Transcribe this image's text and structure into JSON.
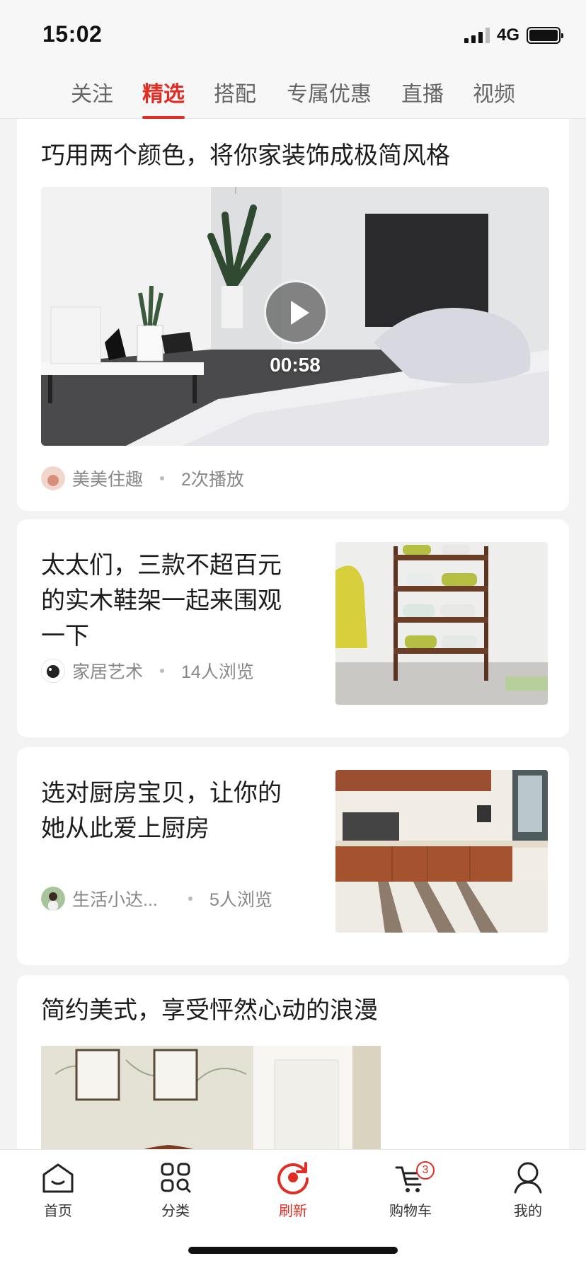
{
  "status_bar": {
    "time": "15:02",
    "network": "4G"
  },
  "top_tabs": [
    {
      "label": "关注",
      "active": false
    },
    {
      "label": "精选",
      "active": true
    },
    {
      "label": "搭配",
      "active": false
    },
    {
      "label": "专属优惠",
      "active": false
    },
    {
      "label": "直播",
      "active": false
    },
    {
      "label": "视频",
      "active": false
    }
  ],
  "feed": [
    {
      "title": "巧用两个颜色，将你家装饰成极简风格",
      "duration": "00:58",
      "author": "美美住趣",
      "stat": "2次播放"
    },
    {
      "title": "太太们，三款不超百元的实木鞋架一起来围观一下",
      "author": "家居艺术",
      "stat": "14人浏览"
    },
    {
      "title": "选对厨房宝贝，让你的她从此爱上厨房",
      "author": "生活小达...",
      "stat": "5人浏览"
    },
    {
      "title": "简约美式，享受怦然心动的浪漫"
    }
  ],
  "bottom_nav": [
    {
      "label": "首页",
      "icon": "home-icon"
    },
    {
      "label": "分类",
      "icon": "category-icon"
    },
    {
      "label": "刷新",
      "icon": "refresh-icon",
      "active": true
    },
    {
      "label": "购物车",
      "icon": "cart-icon",
      "badge": "3"
    },
    {
      "label": "我的",
      "icon": "profile-icon"
    }
  ],
  "colors": {
    "accent": "#e02e24",
    "background": "#f3f3f3"
  }
}
